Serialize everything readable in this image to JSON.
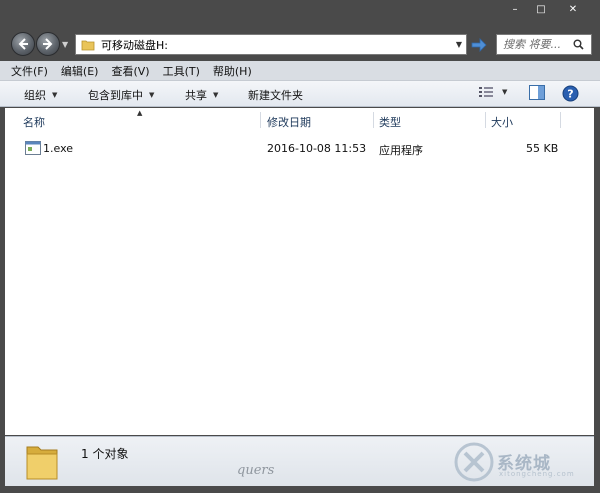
{
  "window": {
    "controls": [
      "–",
      "□",
      "✕"
    ]
  },
  "address_bar": {
    "path": "可移动磁盘H:"
  },
  "search": {
    "placeholder": "搜索 将要..."
  },
  "menu": [
    "文件(F)",
    "编辑(E)",
    "查看(V)",
    "工具(T)",
    "帮助(H)"
  ],
  "toolbar": {
    "organize": "组织",
    "include_library": "包含到库中",
    "share": "共享",
    "new_folder": "新建文件夹"
  },
  "columns": {
    "name": "名称",
    "modified": "修改日期",
    "type": "类型",
    "size": "大小"
  },
  "files": [
    {
      "name": "1.exe",
      "modified": "2016-10-08 11:53",
      "type": "应用程序",
      "size": "55 KB"
    }
  ],
  "status": {
    "count_text": "1 个对象"
  },
  "watermark": {
    "brand": "系统城",
    "url": "xitongcheng.com",
    "signature": "quers"
  },
  "colors": {
    "chrome": "#4a4a4a",
    "menubar": "#d9dde3",
    "header_text": "#1e395b",
    "help_blue": "#2a5fb0"
  }
}
